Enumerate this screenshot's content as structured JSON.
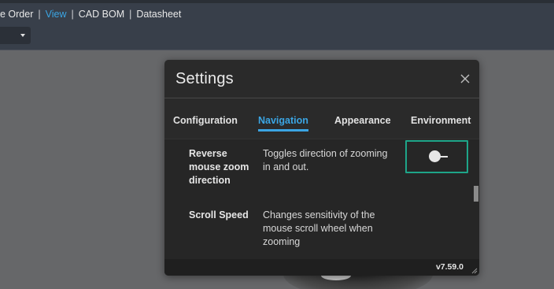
{
  "menu": {
    "items": [
      "e Order",
      "View",
      "CAD BOM",
      "Datasheet"
    ],
    "active": "View"
  },
  "dialog": {
    "title": "Settings",
    "close_icon": "close-icon",
    "tabs": [
      "Configuration",
      "Navigation",
      "Appearance",
      "Environment"
    ],
    "active_tab": "Navigation",
    "settings": [
      {
        "name": "Reverse mouse zoom direction",
        "description": "Toggles direction of zooming in and out.",
        "control": "toggle",
        "value": false
      },
      {
        "name": "Scroll Speed",
        "description": "Changes sensitivity of the mouse scroll wheel when zooming"
      }
    ],
    "version": "v7.59.0"
  },
  "colors": {
    "accent": "#3ba5e3",
    "focus_outline": "#1ea589",
    "dialog_bg": "#2a2a2a",
    "topbar_bg": "#383f4a",
    "canvas_bg": "#666769"
  }
}
